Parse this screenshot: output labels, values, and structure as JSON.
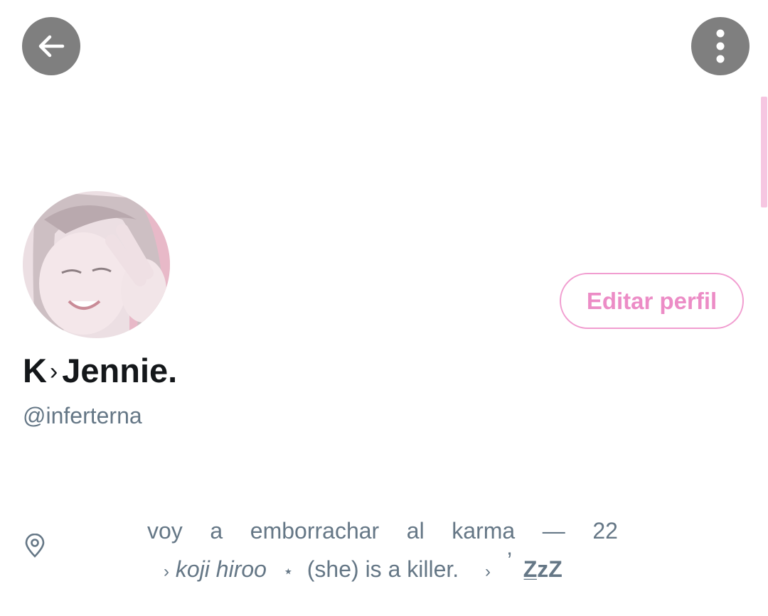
{
  "header": {
    "back_icon": "arrow-left-icon",
    "more_icon": "more-vertical-icon"
  },
  "profile": {
    "display_name_first": "K",
    "display_name_sep": "›",
    "display_name_rest": "Jennie.",
    "handle": "@inferterna",
    "edit_button_label": "Editar perfil",
    "accent_color": "#ec8cc6"
  },
  "bio": {
    "location_icon": "location-pin-icon",
    "line1_words": [
      "voy",
      "a",
      "emborrachar",
      "al",
      "karma",
      "—",
      "22"
    ],
    "line2": {
      "prefix": "›",
      "italic": " koji hiroo",
      "star": "⋆",
      "text": " (she) is a killer.",
      "arrow": "›",
      "quote": "’",
      "zzz": "Z̲zZ"
    }
  }
}
